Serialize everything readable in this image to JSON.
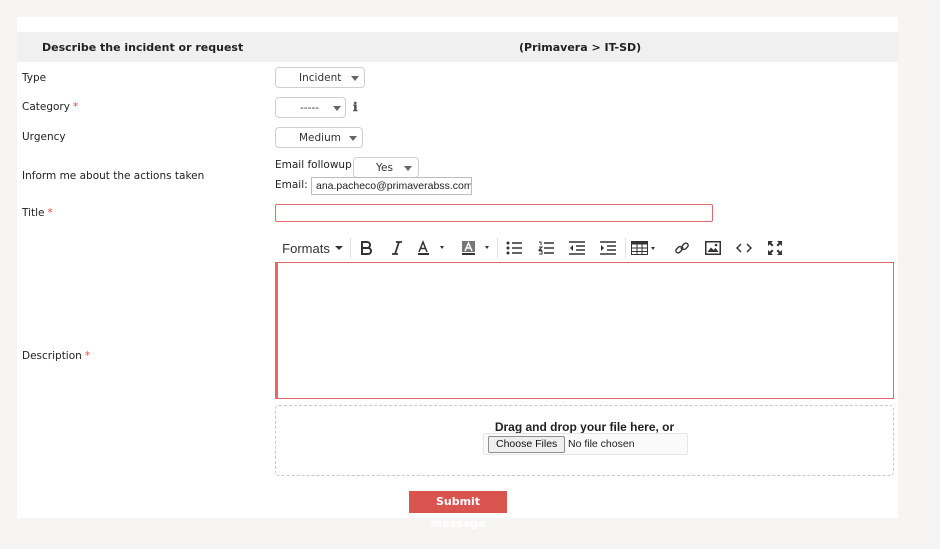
{
  "header": {
    "left_title": "Describe the incident or request",
    "right_title": "(Primavera > IT-SD)"
  },
  "fields": {
    "type": {
      "label": "Type",
      "value": "Incident"
    },
    "category": {
      "label": "Category",
      "required_mark": "*",
      "value": "-----",
      "info_icon": "info-icon"
    },
    "urgency": {
      "label": "Urgency",
      "value": "Medium"
    },
    "inform": {
      "label": "Inform me about the actions taken",
      "followup_label": "Email followup",
      "followup_value": "Yes",
      "email_label": "Email:",
      "email_value": "ana.pacheco@primaverabss.com"
    },
    "title": {
      "label": "Title",
      "required_mark": "*",
      "value": ""
    },
    "description": {
      "label": "Description",
      "required_mark": "*"
    }
  },
  "editor_toolbar": {
    "formats_label": "Formats",
    "icons": [
      "bold-icon",
      "italic-icon",
      "text-color-icon",
      "background-color-icon",
      "bullet-list-icon",
      "numbered-list-icon",
      "outdent-icon",
      "indent-icon",
      "table-icon",
      "link-icon",
      "image-icon",
      "source-code-icon",
      "fullscreen-icon"
    ]
  },
  "upload": {
    "drop_text": "Drag and drop your file here, or",
    "button_label": "Choose Files",
    "status_text": "No file chosen"
  },
  "submit_label": "Submit message",
  "colors": {
    "accent_red": "#d9534f",
    "required_red": "#e04b4b",
    "header_bg": "#f0f0f0",
    "page_bg": "#f6f5f3"
  }
}
